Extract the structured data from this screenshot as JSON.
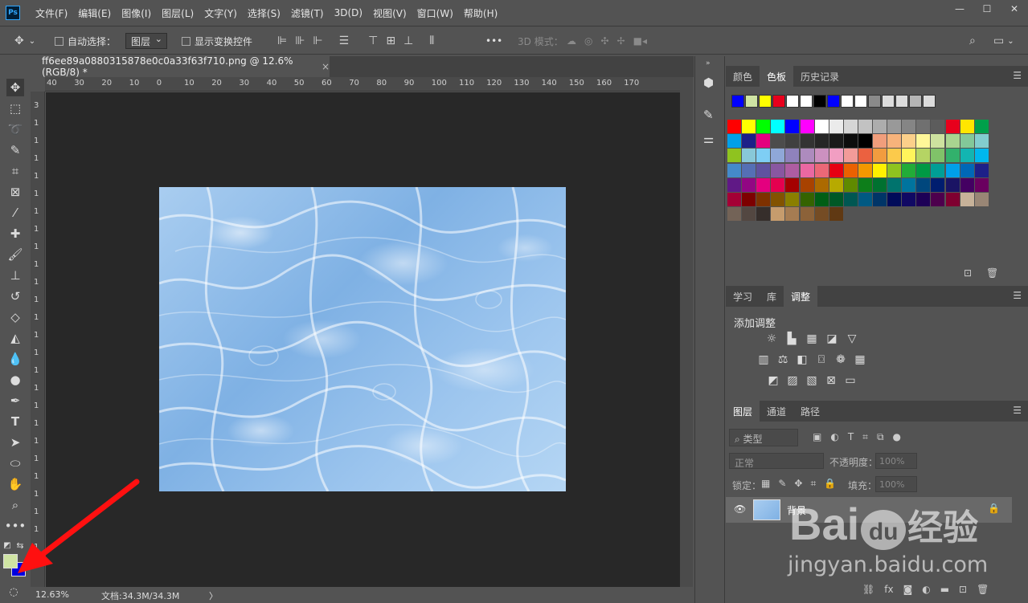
{
  "menubar": {
    "logo": "Ps",
    "items": [
      "文件(F)",
      "编辑(E)",
      "图像(I)",
      "图层(L)",
      "文字(Y)",
      "选择(S)",
      "滤镜(T)",
      "3D(D)",
      "视图(V)",
      "窗口(W)",
      "帮助(H)"
    ]
  },
  "options": {
    "auto_select": "自动选择：",
    "layer_dropdown": "图层",
    "show_transform": "显示变换控件",
    "mode_3d": "3D 模式："
  },
  "document": {
    "tab_title": "ff6ee89a0880315878e0c0a33f63f710.png @ 12.6%(RGB/8) *",
    "close": "×"
  },
  "ruler_h": [
    "40",
    "30",
    "20",
    "10",
    "0",
    "10",
    "20",
    "30",
    "40",
    "50",
    "60",
    "70",
    "80",
    "90",
    "100",
    "110",
    "120",
    "130",
    "140",
    "150",
    "160",
    "170"
  ],
  "ruler_v": [
    "3",
    "1",
    "1",
    "1",
    "1",
    "1",
    "1",
    "1",
    "1",
    "1",
    "1",
    "1",
    "1",
    "1",
    "1",
    "1",
    "1",
    "1",
    "1",
    "1",
    "1",
    "1",
    "1",
    "1",
    "1",
    "1",
    "3"
  ],
  "status": {
    "zoom": "12.63%",
    "doc": "文档:34.3M/34.3M",
    "arrow": "〉"
  },
  "color_panel": {
    "tabs": [
      "颜色",
      "色板",
      "历史记录"
    ],
    "active_tab": "色板",
    "recent": [
      "#0000ff",
      "#cfe4a3",
      "#ffff00",
      "#e8001c",
      "#ffffff",
      "#ffffff",
      "#000000",
      "#0000ff",
      "#ffffff",
      "#ffffff",
      "#8a8a8a",
      "#dcdcdc",
      "#dcdcdc",
      "#b5b5b5",
      "#dcdcdc"
    ],
    "rows": [
      [
        "#ff0000",
        "#ffff00",
        "#00ff00",
        "#00ffff",
        "#0000ff",
        "#ff00ff",
        "#ffffff",
        "#ebebeb",
        "#d6d6d6",
        "#c2c2c2",
        "#adadad",
        "#999999",
        "#858585",
        "#707070",
        "#5c5c5c",
        "#e8001c",
        "#ffe600",
        "#00a04a"
      ],
      [
        "#00a0e9",
        "#1d2088",
        "#e4007f",
        "#4c4c4c",
        "#404040",
        "#333333",
        "#262626",
        "#1a1a1a",
        "#0d0d0d",
        "#000000",
        "#f19e7c",
        "#f7b37b",
        "#fcd08a",
        "#fff799",
        "#cde29f",
        "#a9d490",
        "#83c899",
        "#83cdce"
      ],
      [
        "#8fc31f",
        "#88c8d8",
        "#7ecef4",
        "#8fa8d8",
        "#8f82bc",
        "#ad8bbe",
        "#cc91c0",
        "#f19ec2",
        "#f29b99",
        "#eb6140",
        "#f29c3f",
        "#fcca4b",
        "#fff45b",
        "#b5d464",
        "#80c269",
        "#32b16c",
        "#13b5b1",
        "#00b7ee"
      ],
      [
        "#448aca",
        "#556fb5",
        "#5f52a0",
        "#8957a1",
        "#ae5da1",
        "#ea68a2",
        "#eb6877",
        "#e60012",
        "#eb6100",
        "#f39800",
        "#fff100",
        "#8fc31f",
        "#22ac38",
        "#009944",
        "#009e96",
        "#00a0e9",
        "#0068b7",
        "#1d2088"
      ],
      [
        "#601986",
        "#920783",
        "#e4007f",
        "#e5004f",
        "#a40000",
        "#a84200",
        "#ac6a00",
        "#b7aa00",
        "#5f8a00",
        "#0d7e1a",
        "#007130",
        "#00736d",
        "#00749e",
        "#00477d",
        "#001d6f",
        "#1a1464",
        "#440062",
        "#6a005f"
      ],
      [
        "#a40035",
        "#7d0000",
        "#7e3100",
        "#825300",
        "#8a7f00",
        "#356300",
        "#005e15",
        "#005826",
        "#005752",
        "#005982",
        "#003567",
        "#000b59",
        "#100963",
        "#1d0056",
        "#4d004d",
        "#7f0030",
        "#c7b299",
        "#998675"
      ],
      [
        "#736357",
        "#534741",
        "#362e2b",
        "#c69c6d",
        "#a67c52",
        "#8c6239",
        "#754c24",
        "#603913"
      ]
    ]
  },
  "adjust_panel": {
    "tabs": [
      "学习",
      "库",
      "调整"
    ],
    "active_tab": "调整",
    "title": "添加调整"
  },
  "layers_panel": {
    "tabs": [
      "图层",
      "通道",
      "路径"
    ],
    "active_tab": "图层",
    "filter": "类型",
    "blend": "正常",
    "opacity_label": "不透明度：",
    "opacity_value": "100%",
    "lock_label": "锁定：",
    "fill_label": "填充：",
    "fill_value": "100%",
    "layer_name": "背景"
  },
  "watermark": {
    "brand1": "Bai",
    "brand2": "du",
    "brand3": "经验",
    "url": "jingyan.baidu.com"
  },
  "colors": {
    "foreground": "#cfe4a3",
    "background": "#0000e0",
    "arrow": "#ff1010"
  }
}
